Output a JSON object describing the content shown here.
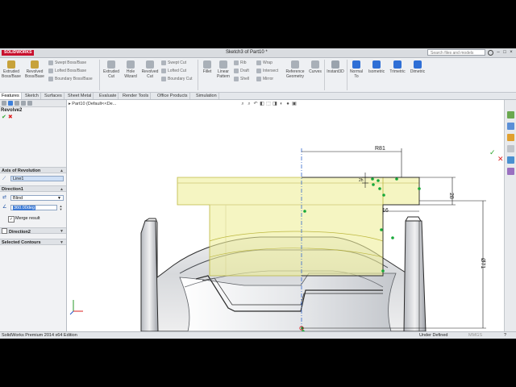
{
  "app": {
    "logo": "SOLIDWORKS",
    "title": "Sketch3 of Part10 *",
    "search_placeholder": "Search files and models"
  },
  "ribbon": {
    "big": [
      "Extruded Boss/Base",
      "Revolved Boss/Base",
      "Extruded Cut",
      "Hole Wizard",
      "Revolved Cut",
      "Fillet",
      "Linear Pattern",
      "Reference Geometry",
      "Curves",
      "Instant3D",
      "Normal To",
      "Isometric",
      "Trimetric",
      "Dimetric"
    ],
    "small": [
      "Swept Boss/Base",
      "Lofted Boss/Base",
      "Boundary Boss/Base",
      "Swept Cut",
      "Lofted Cut",
      "Boundary Cut",
      "Rib",
      "Draft",
      "Shell",
      "Wrap",
      "Intersect",
      "Mirror"
    ]
  },
  "tabs": [
    "Features",
    "Sketch",
    "Surfaces",
    "Sheet Metal",
    "Evaluate",
    "Render Tools",
    "Office Products",
    "Simulation"
  ],
  "panel": {
    "feature": "Revolve2",
    "axis_header": "Axis of Revolution",
    "axis_value": "Line1",
    "dir1_header": "Direction1",
    "end_condition": "Blind",
    "angle": "360.00deg",
    "merge_label": "Merge result",
    "dir2_header": "Direction2",
    "contours_header": "Selected Contours"
  },
  "viewport": {
    "tree": "Part10  (Default<<De...",
    "dims": {
      "r": "R81",
      "d1": "2h",
      "d2": "28",
      "d3": "16",
      "d4": "Ø71"
    }
  },
  "status": {
    "left": "SolidWorks Premium 2014 x64 Edition",
    "state": "Under Defined",
    "units": "MMGS"
  },
  "colors": {
    "accent": "#c8102e",
    "preview": "#eeee9a",
    "dimension": "#1a1a1a",
    "sketch_point": "#17a839"
  }
}
